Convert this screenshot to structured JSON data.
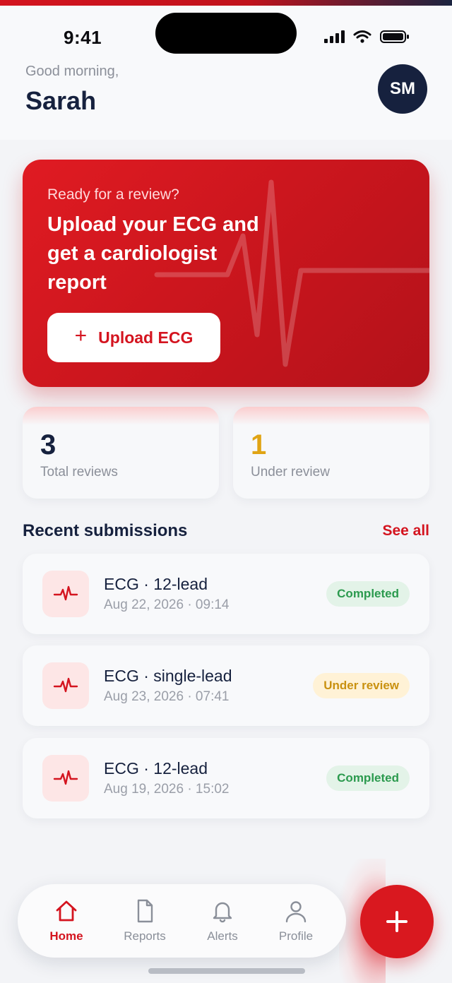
{
  "status_bar": {
    "time": "9:41"
  },
  "header": {
    "greeting": "Good morning,",
    "name": "Sarah",
    "avatar_initials": "SM"
  },
  "hero": {
    "kicker": "Ready for a review?",
    "title": "Upload your ECG and get a cardiologist report",
    "button_label": "Upload ECG",
    "button_icon": "plus-icon"
  },
  "stats": [
    {
      "value": "3",
      "label": "Total reviews",
      "color": "#16213e"
    },
    {
      "value": "1",
      "label": "Under review",
      "color": "#e0a414"
    }
  ],
  "recent": {
    "title": "Recent submissions",
    "see_all": "See all",
    "items": [
      {
        "title": "ECG · 12-lead",
        "date": "Aug 22, 2026 · 09:14",
        "status": "Completed",
        "status_type": "done",
        "icon": "heartbeat-icon"
      },
      {
        "title": "ECG · single-lead",
        "date": "Aug 23, 2026 · 07:41",
        "status": "Under review",
        "status_type": "review",
        "icon": "heartbeat-icon"
      },
      {
        "title": "ECG · 12-lead",
        "date": "Aug 19, 2026 · 15:02",
        "status": "Completed",
        "status_type": "done",
        "icon": "heartbeat-icon"
      }
    ]
  },
  "nav": {
    "items": [
      {
        "label": "Home",
        "icon": "home-icon",
        "active": true
      },
      {
        "label": "Reports",
        "icon": "document-icon",
        "active": false
      },
      {
        "label": "Alerts",
        "icon": "bell-icon",
        "active": false
      },
      {
        "label": "Profile",
        "icon": "user-icon",
        "active": false
      }
    ]
  },
  "fab": {
    "icon": "plus-icon"
  },
  "colors": {
    "accent": "#d4141f",
    "navy": "#16213e",
    "success": "#2b9a4e",
    "warning": "#c99110"
  }
}
